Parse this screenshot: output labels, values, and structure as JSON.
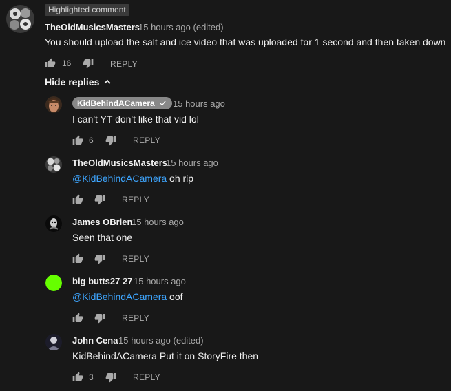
{
  "main_comment": {
    "highlight_label": "Highlighted comment",
    "author": "TheOldMusicsMasters",
    "time": "15 hours ago (edited)",
    "text": "You should upload the salt and ice video that was uploaded for 1 second and then taken down",
    "likes": "16",
    "reply_label": "REPLY"
  },
  "hide_replies_label": "Hide replies",
  "replies": [
    {
      "author": "KidBehindACamera",
      "time": "15 hours ago",
      "text": "I can't YT don't like that vid lol",
      "likes": "6",
      "reply_label": "REPLY"
    },
    {
      "author": "TheOldMusicsMasters",
      "time": "15 hours ago",
      "mention": "@KidBehindACamera",
      "text": " oh rip",
      "reply_label": "REPLY"
    },
    {
      "author": "James OBrien",
      "time": "15 hours ago",
      "text": "Seen that one",
      "reply_label": "REPLY"
    },
    {
      "author": "big butts27 27",
      "time": "15 hours ago",
      "mention": "@KidBehindACamera",
      "text": " oof",
      "reply_label": "REPLY"
    },
    {
      "author": "John Cena",
      "time": "15 hours ago (edited)",
      "text": "KidBehindACamera Put it on StoryFire then",
      "likes": "3",
      "reply_label": "REPLY"
    }
  ],
  "colors": {
    "background": "#181818",
    "text": "#f1f1f1",
    "secondary": "#aaaaaa",
    "link": "#3ea6ff",
    "author_pill": "#888888",
    "green_avatar": "#66ff00"
  },
  "icons": [
    "thumb-up-icon",
    "thumb-down-icon",
    "chevron-up-icon",
    "checkmark-icon"
  ]
}
